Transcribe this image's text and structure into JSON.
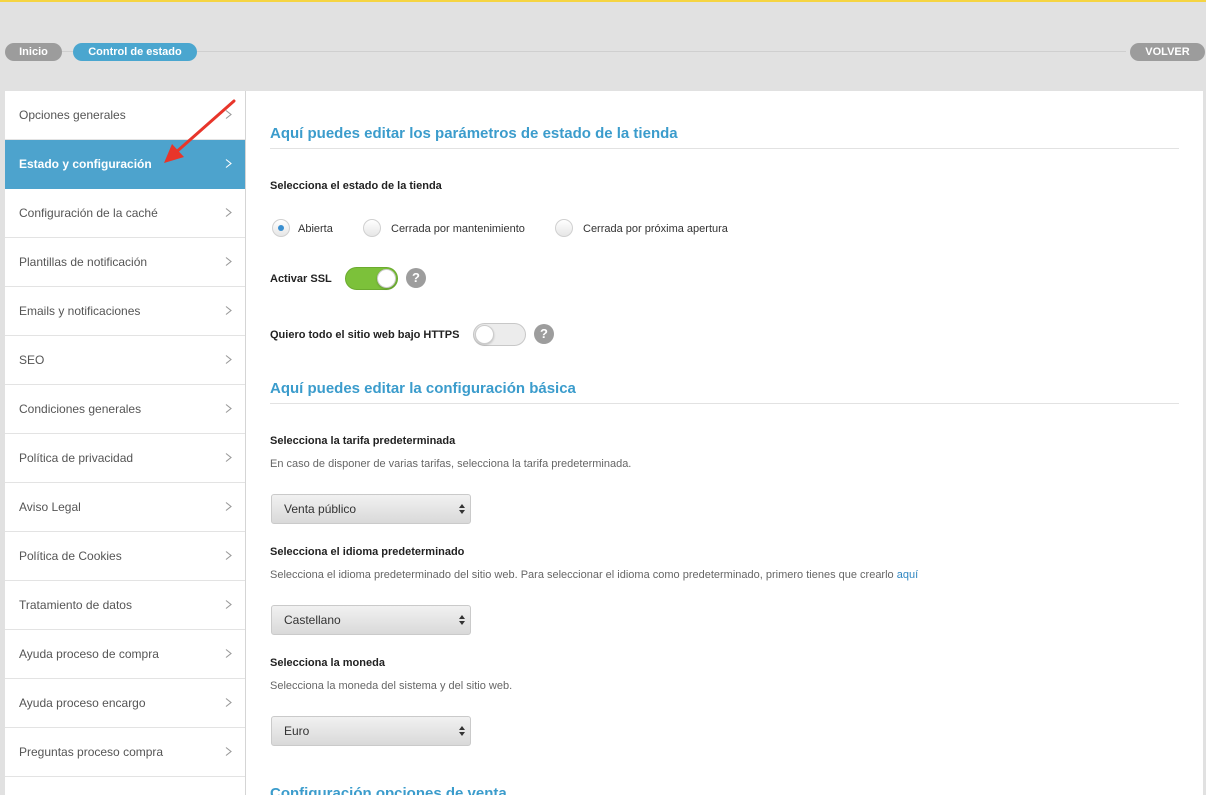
{
  "breadcrumb": {
    "home": "Inicio",
    "current": "Control de estado",
    "back": "VOLVER"
  },
  "sidebar": {
    "items": [
      {
        "label": "Opciones generales"
      },
      {
        "label": "Estado y configuración"
      },
      {
        "label": "Configuración de la caché"
      },
      {
        "label": "Plantillas de notificación"
      },
      {
        "label": "Emails y notificaciones"
      },
      {
        "label": "SEO"
      },
      {
        "label": "Condiciones generales"
      },
      {
        "label": "Política de privacidad"
      },
      {
        "label": "Aviso Legal"
      },
      {
        "label": "Política de Cookies"
      },
      {
        "label": "Tratamiento de datos"
      },
      {
        "label": "Ayuda proceso de compra"
      },
      {
        "label": "Ayuda proceso encargo"
      },
      {
        "label": "Preguntas proceso compra"
      }
    ],
    "active_index": 1
  },
  "status": {
    "title": "Aquí puedes editar los parámetros de estado de la tienda",
    "store_state_label": "Selecciona el estado de la tienda",
    "options": [
      "Abierta",
      "Cerrada por mantenimiento",
      "Cerrada por próxima apertura"
    ],
    "selected": "Abierta",
    "ssl_label": "Activar SSL",
    "ssl_enabled": true,
    "https_label": "Quiero todo el sitio web bajo HTTPS",
    "https_enabled": false,
    "help_glyph": "?"
  },
  "basic": {
    "title": "Aquí puedes editar la configuración básica",
    "tariff": {
      "label": "Selecciona la tarifa predeterminada",
      "hint": "En caso de disponer de varias tarifas, selecciona la tarifa predeterminada.",
      "value": "Venta público"
    },
    "language": {
      "label": "Selecciona el idioma predeterminado",
      "hint": "Selecciona el idioma predeterminado del sitio web. Para seleccionar el idioma como predeterminado, primero tienes que crearlo",
      "link": "aquí",
      "value": "Castellano"
    },
    "currency": {
      "label": "Selecciona la moneda",
      "hint": "Selecciona la moneda del sistema y del sitio web.",
      "value": "Euro"
    }
  },
  "sales": {
    "title": "Configuración opciones de venta"
  },
  "colors": {
    "accent": "#4da3cd",
    "heading": "#3b9ccc",
    "toggle_on": "#7cc13a",
    "arrow": "#e8352a"
  }
}
